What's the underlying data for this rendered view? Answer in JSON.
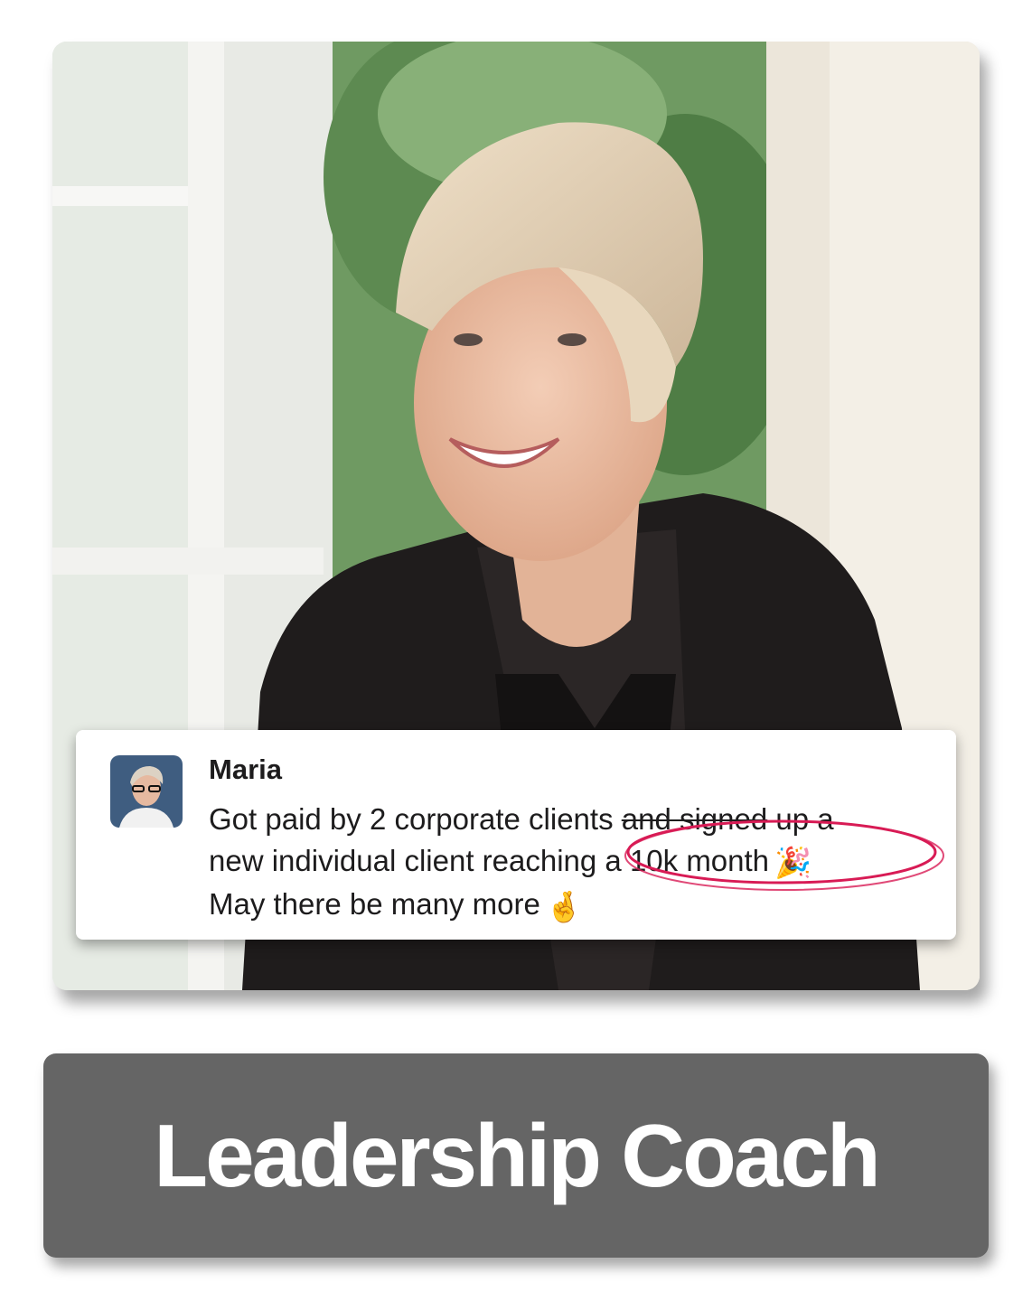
{
  "photo": {
    "description_icon": "portrait-photo"
  },
  "message": {
    "author": "Maria",
    "line1_a": "Got paid by 2 corporate clients ",
    "line1_strike": "and signed",
    "line1_b": " up a",
    "line2": "new individual client reaching a 10k month",
    "line2_emoji": "🎉",
    "line3": "May there be many more",
    "line3_emoji": "🤞",
    "highlight_color": "#d81b55"
  },
  "title": {
    "text": "Leadership Coach",
    "background": "#656565"
  }
}
